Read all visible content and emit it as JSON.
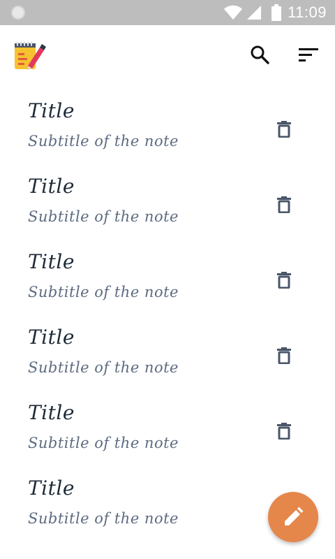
{
  "status_bar": {
    "time": "11:09",
    "icons": [
      "notification-dot-icon",
      "wifi-icon",
      "cellular-signal-icon",
      "battery-icon"
    ]
  },
  "app_bar": {
    "logo_icon": "notepad-pen-icon",
    "search_icon": "search-icon",
    "sort_icon": "sort-icon"
  },
  "notes": [
    {
      "title": "Title",
      "subtitle": "Subtitle of the note"
    },
    {
      "title": "Title",
      "subtitle": "Subtitle of the note"
    },
    {
      "title": "Title",
      "subtitle": "Subtitle of the note"
    },
    {
      "title": "Title",
      "subtitle": "Subtitle of the note"
    },
    {
      "title": "Title",
      "subtitle": "Subtitle of the note"
    },
    {
      "title": "Title",
      "subtitle": "Subtitle of the note"
    }
  ],
  "fab": {
    "icon": "pencil-icon",
    "color": "#e5864a"
  },
  "colors": {
    "status_bar": "#bdbdbd",
    "title_text": "#1e2a38",
    "subtitle_text": "#5d6b80",
    "icon_gray": "#4a5568"
  }
}
